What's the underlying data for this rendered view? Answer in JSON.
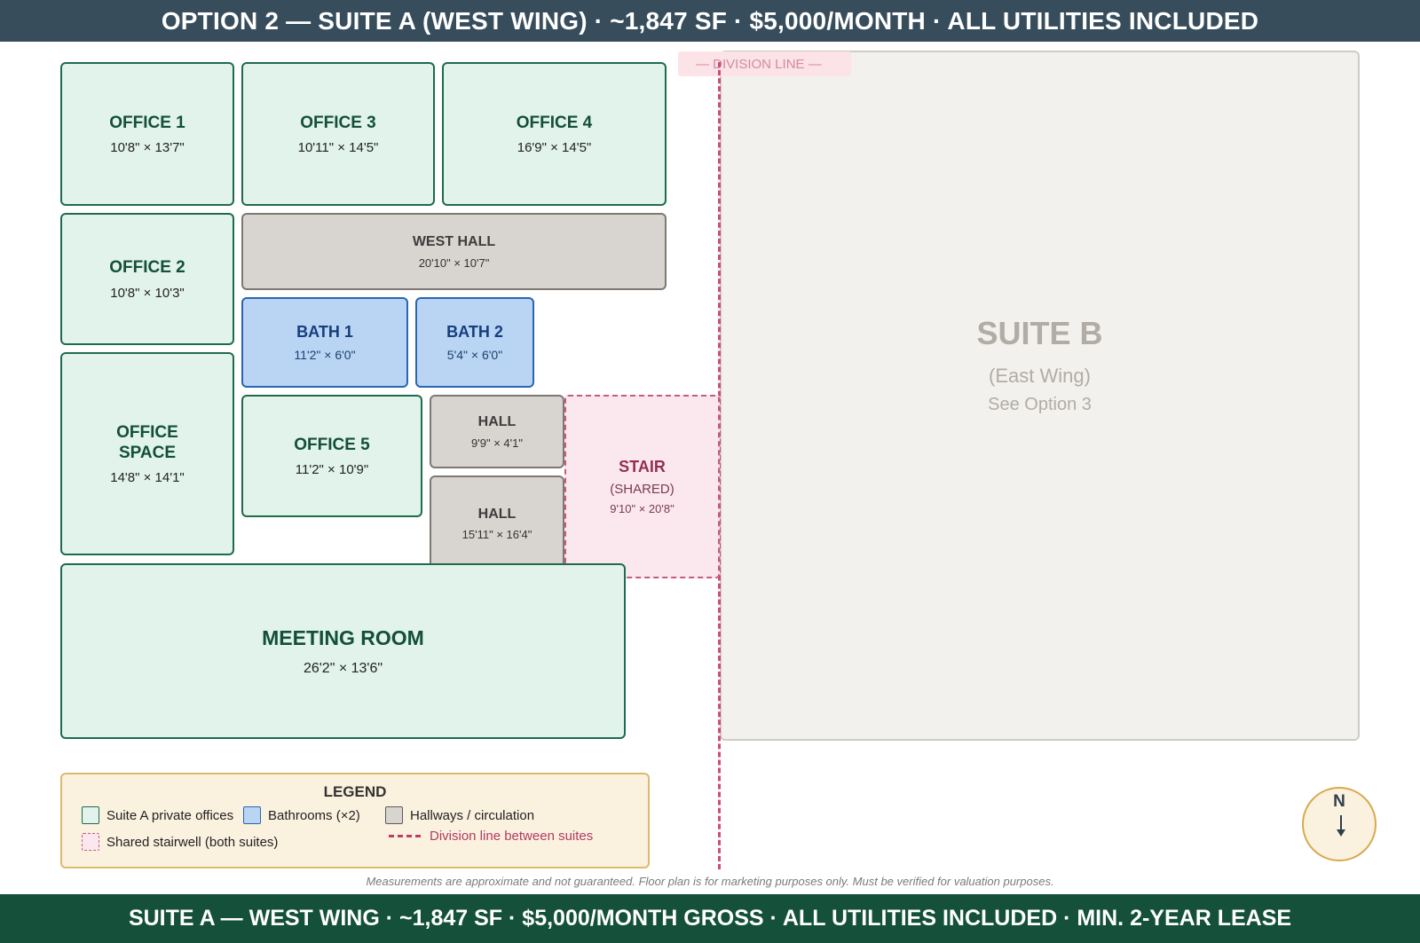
{
  "header": {
    "banner": "OPTION 2 — SUITE A (WEST WING) · ~1,847 SF · $5,000/MONTH · ALL UTILITIES INCLUDED"
  },
  "rooms": {
    "office1": {
      "name": "OFFICE 1",
      "dim": "10'8\" × 13'7\""
    },
    "office3": {
      "name": "OFFICE 3",
      "dim": "10'11\" × 14'5\""
    },
    "office4": {
      "name": "OFFICE 4",
      "dim": "16'9\" × 14'5\""
    },
    "office2": {
      "name": "OFFICE 2",
      "dim": "10'8\" × 10'3\""
    },
    "west_hall": {
      "name": "WEST HALL",
      "dim": "20'10\" × 10'7\""
    },
    "bath1": {
      "name": "BATH 1",
      "dim": "11'2\" × 6'0\""
    },
    "bath2": {
      "name": "BATH 2",
      "dim": "5'4\" × 6'0\""
    },
    "office_space": {
      "name_line1": "OFFICE",
      "name_line2": "SPACE",
      "dim": "14'8\" × 14'1\""
    },
    "office5": {
      "name": "OFFICE 5",
      "dim": "11'2\" × 10'9\""
    },
    "hall_small": {
      "name": "HALL",
      "dim": "9'9\" × 4'1\""
    },
    "hall_large": {
      "name": "HALL",
      "dim": "15'11\" × 16'4\""
    },
    "stair": {
      "name": "STAIR",
      "sub": "(SHARED)",
      "dim": "9'10\" × 20'8\""
    },
    "meeting": {
      "name": "MEETING ROOM",
      "dim": "26'2\" × 13'6\""
    }
  },
  "suite_b": {
    "name": "SUITE B",
    "wing": "(East Wing)",
    "see": "See Option 3"
  },
  "division": {
    "label": "— DIVISION LINE —"
  },
  "legend": {
    "title": "LEGEND",
    "private_offices": "Suite A private offices",
    "bathrooms": "Bathrooms (×2)",
    "hallways": "Hallways / circulation",
    "stairwell": "Shared stairwell (both suites)",
    "division_line": "Division line between suites"
  },
  "compass": {
    "label": "N",
    "pointing": "down"
  },
  "disclaimer": "Measurements are approximate and not guaranteed. Floor plan is for marketing purposes only. Must be verified for valuation purposes.",
  "footer": {
    "banner": "SUITE A — WEST WING · ~1,847 SF · $5,000/MONTH GROSS · ALL UTILITIES INCLUDED · MIN. 2-YEAR LEASE"
  },
  "colors": {
    "header_bg": "#374d5c",
    "footer_bg": "#14503a",
    "office_fill": "#e1f3ea",
    "bath_fill": "#b9d5f3",
    "hall_fill": "#d8d4cf",
    "stair_fill": "#fbe8ee",
    "division_line": "#cc4c7b"
  }
}
